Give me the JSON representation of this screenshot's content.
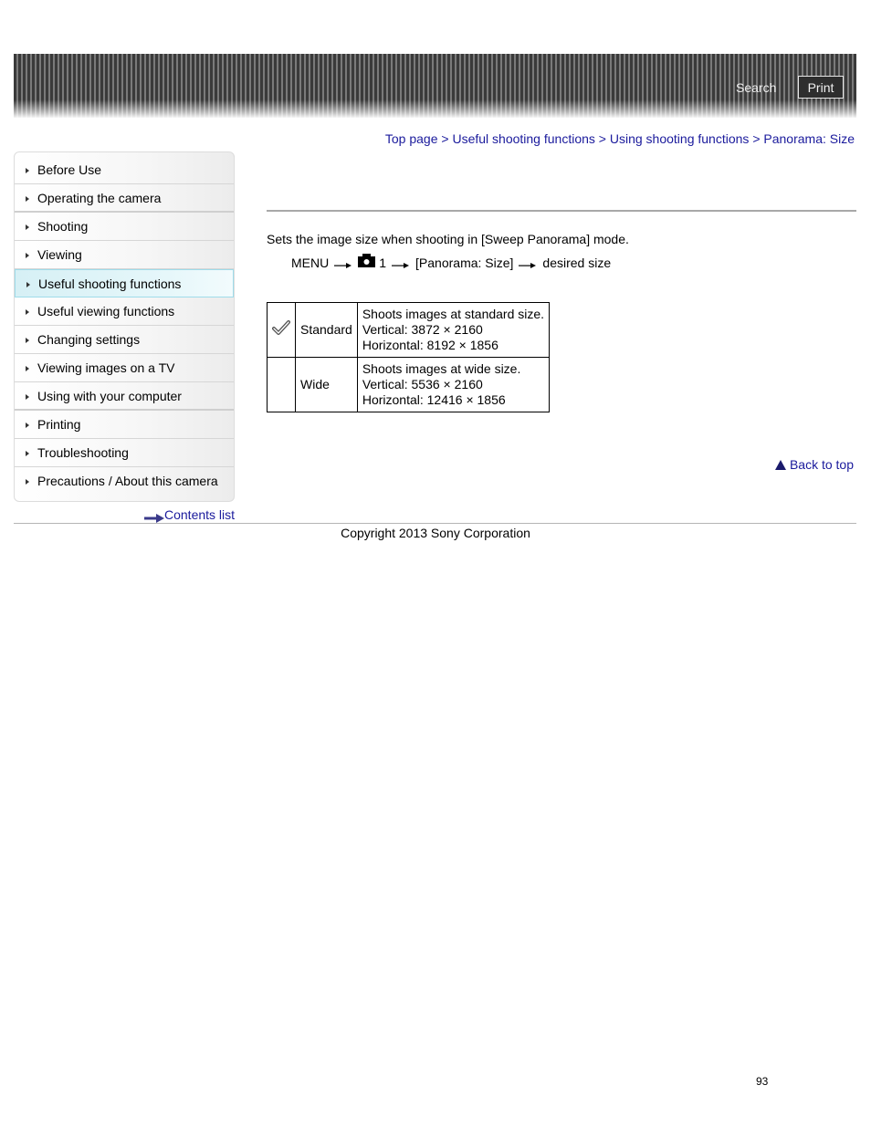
{
  "header": {
    "search_label": "Search",
    "print_label": "Print"
  },
  "breadcrumb": {
    "items": [
      "Top page",
      "Useful shooting functions",
      "Using shooting functions",
      "Panorama: Size"
    ],
    "separator": ">"
  },
  "sidebar": {
    "items": [
      {
        "label": "Before Use"
      },
      {
        "label": "Operating the camera"
      },
      {
        "label": "Shooting"
      },
      {
        "label": "Viewing"
      },
      {
        "label": "Useful shooting functions",
        "active": true
      },
      {
        "label": "Useful viewing functions"
      },
      {
        "label": "Changing settings"
      },
      {
        "label": "Viewing images on a TV"
      },
      {
        "label": "Using with your computer"
      },
      {
        "label": "Printing"
      },
      {
        "label": "Troubleshooting"
      },
      {
        "label": "Precautions / About this camera"
      }
    ],
    "contents_list_label": "Contents list"
  },
  "main": {
    "description": "Sets the image size when shooting in [Sweep Panorama] mode.",
    "menu_path": {
      "menu": "MENU",
      "tab_icon": "camera-icon",
      "tab_number": "1",
      "item": "[Panorama: Size]",
      "final": "desired size"
    },
    "table": {
      "rows": [
        {
          "default": true,
          "name": "Standard",
          "lines": [
            "Shoots images at standard size.",
            "Vertical: 3872 × 2160",
            "Horizontal: 8192 × 1856"
          ]
        },
        {
          "default": false,
          "name": "Wide",
          "lines": [
            "Shoots images at wide size.",
            "Vertical: 5536 × 2160",
            "Horizontal: 12416 × 1856"
          ]
        }
      ]
    },
    "back_to_top_label": "Back to top"
  },
  "footer": {
    "copyright": "Copyright 2013 Sony Corporation",
    "page_number": "93"
  }
}
